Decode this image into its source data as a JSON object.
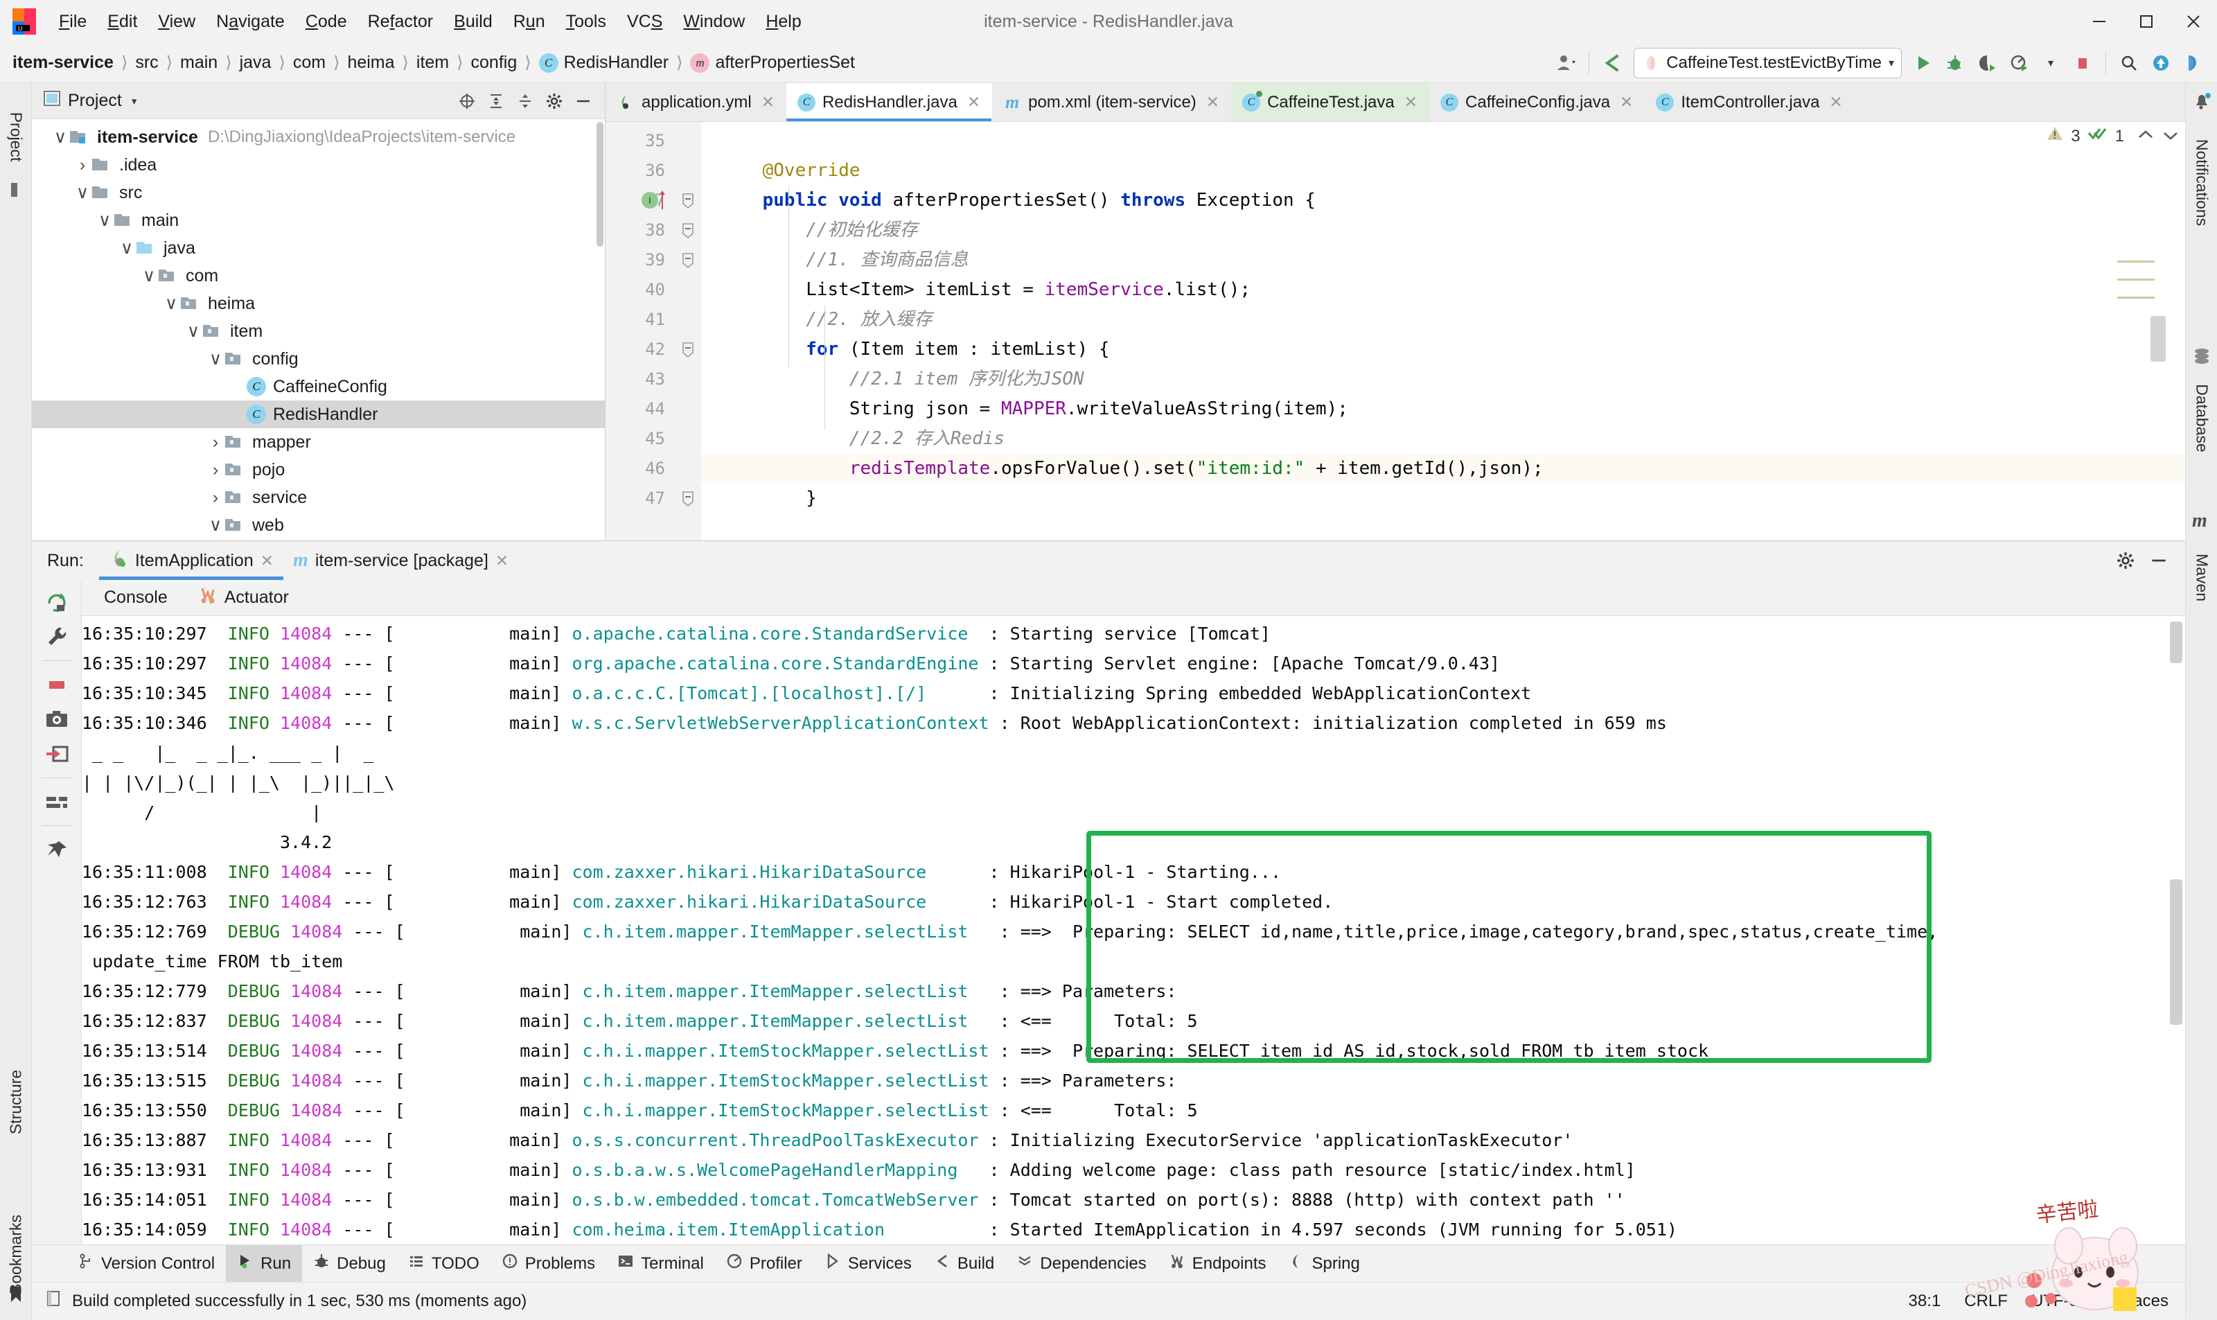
{
  "window": {
    "title": "item-service - RedisHandler.java",
    "logo_name": "intellij-idea-logo"
  },
  "menubar": {
    "items": [
      "File",
      "Edit",
      "View",
      "Navigate",
      "Code",
      "Refactor",
      "Build",
      "Run",
      "Tools",
      "VCS",
      "Window",
      "Help"
    ]
  },
  "window_controls": {
    "minimize": "minimize-button",
    "maximize": "maximize-button",
    "close": "close-button"
  },
  "navbar": {
    "crumbs": [
      {
        "label": "item-service",
        "bold": true,
        "badge": ""
      },
      {
        "label": "src",
        "bold": false,
        "badge": ""
      },
      {
        "label": "main",
        "bold": false,
        "badge": ""
      },
      {
        "label": "java",
        "bold": false,
        "badge": ""
      },
      {
        "label": "com",
        "bold": false,
        "badge": ""
      },
      {
        "label": "heima",
        "bold": false,
        "badge": ""
      },
      {
        "label": "item",
        "bold": false,
        "badge": ""
      },
      {
        "label": "config",
        "bold": false,
        "badge": ""
      },
      {
        "label": "RedisHandler",
        "bold": false,
        "badge": "C"
      },
      {
        "label": "afterPropertiesSet",
        "bold": false,
        "badge": "m"
      }
    ],
    "separator": "›",
    "run_config": "CaffeineTest.testEvictByTime",
    "run_config_caret": "▾",
    "buttons": [
      "user-icon",
      "vcs-update-icon",
      "run-button",
      "debug-button",
      "run-coverage-button",
      "profile-button",
      "stop-button",
      "search-everywhere-button",
      "update-project-button",
      "ide-assistant-button"
    ]
  },
  "project_pane": {
    "title": "Project",
    "caret": "▾",
    "toolbar_icons": [
      "scroll-from-source-icon",
      "expand-all-icon",
      "collapse-all-icon",
      "settings-gear-icon",
      "hide-icon"
    ],
    "tree": [
      {
        "depth": 0,
        "twist": "∨",
        "icon": "module",
        "label": "item-service",
        "bold": true,
        "path": "D:\\DingJiaxiong\\IdeaProjects\\item-service",
        "selected": false
      },
      {
        "depth": 1,
        "twist": "›",
        "icon": "folder",
        "label": ".idea",
        "bold": false,
        "path": "",
        "selected": false
      },
      {
        "depth": 1,
        "twist": "∨",
        "icon": "folder",
        "label": "src",
        "bold": false,
        "path": "",
        "selected": false
      },
      {
        "depth": 2,
        "twist": "∨",
        "icon": "folder",
        "label": "main",
        "bold": false,
        "path": "",
        "selected": false
      },
      {
        "depth": 3,
        "twist": "∨",
        "icon": "source-folder",
        "label": "java",
        "bold": false,
        "path": "",
        "selected": false
      },
      {
        "depth": 4,
        "twist": "∨",
        "icon": "package",
        "label": "com",
        "bold": false,
        "path": "",
        "selected": false
      },
      {
        "depth": 5,
        "twist": "∨",
        "icon": "package",
        "label": "heima",
        "bold": false,
        "path": "",
        "selected": false
      },
      {
        "depth": 6,
        "twist": "∨",
        "icon": "package",
        "label": "item",
        "bold": false,
        "path": "",
        "selected": false
      },
      {
        "depth": 7,
        "twist": "∨",
        "icon": "package",
        "label": "config",
        "bold": false,
        "path": "",
        "selected": false
      },
      {
        "depth": 8,
        "twist": "",
        "icon": "class",
        "label": "CaffeineConfig",
        "bold": false,
        "path": "",
        "selected": false
      },
      {
        "depth": 8,
        "twist": "",
        "icon": "class",
        "label": "RedisHandler",
        "bold": false,
        "path": "",
        "selected": true
      },
      {
        "depth": 7,
        "twist": "›",
        "icon": "package",
        "label": "mapper",
        "bold": false,
        "path": "",
        "selected": false
      },
      {
        "depth": 7,
        "twist": "›",
        "icon": "package",
        "label": "pojo",
        "bold": false,
        "path": "",
        "selected": false
      },
      {
        "depth": 7,
        "twist": "›",
        "icon": "package",
        "label": "service",
        "bold": false,
        "path": "",
        "selected": false
      },
      {
        "depth": 7,
        "twist": "∨",
        "icon": "package",
        "label": "web",
        "bold": false,
        "path": "",
        "selected": false
      }
    ]
  },
  "editor": {
    "tabs": [
      {
        "label": "application.yml",
        "icon": "yaml-file-icon",
        "state": "normal"
      },
      {
        "label": "RedisHandler.java",
        "icon": "java-class-icon",
        "state": "active"
      },
      {
        "label": "pom.xml (item-service)",
        "icon": "maven-file-icon",
        "state": "normal"
      },
      {
        "label": "CaffeineTest.java",
        "icon": "java-test-icon",
        "state": "test"
      },
      {
        "label": "CaffeineConfig.java",
        "icon": "java-class-icon",
        "state": "normal"
      },
      {
        "label": "ItemController.java",
        "icon": "java-class-icon",
        "state": "normal"
      }
    ],
    "close_glyph": "✕",
    "inspection": {
      "warning_count": "3",
      "ok_count": "1",
      "up": "⌃",
      "down": "⌄",
      "kebab": "⋮"
    },
    "lines": [
      {
        "num": "35",
        "fold": "",
        "html": "",
        "highlight": false
      },
      {
        "num": "36",
        "fold": "",
        "html": "    <span class=\"ann\">@Override</span>",
        "highlight": false
      },
      {
        "num": "37",
        "fold": "minus",
        "html": "    <span class=\"kw\">public</span> <span class=\"kw\">void</span> afterPropertiesSet() <span class=\"kw\">throws</span> Exception {",
        "highlight": false
      },
      {
        "num": "38",
        "fold": "minus",
        "html": "        <span class=\"cmt\">//初始化缓存</span>",
        "highlight": false
      },
      {
        "num": "39",
        "fold": "minus",
        "html": "        <span class=\"cmt\">//1. 查询商品信息</span>",
        "highlight": false
      },
      {
        "num": "40",
        "fold": "",
        "html": "        List&lt;Item&gt; itemList = <span class=\"fld\">itemService</span>.list();",
        "highlight": false
      },
      {
        "num": "41",
        "fold": "",
        "html": "        <span class=\"cmt\">//2. 放入缓存</span>",
        "highlight": false
      },
      {
        "num": "42",
        "fold": "minus",
        "html": "        <span class=\"kw\">for</span> (Item item : itemList) {",
        "highlight": false
      },
      {
        "num": "43",
        "fold": "",
        "html": "            <span class=\"cmt\">//2.1 item 序列化为JSON</span>",
        "highlight": false
      },
      {
        "num": "44",
        "fold": "",
        "html": "            String json = <span class=\"fld\">MAPPER</span>.writeValueAsString(item);",
        "highlight": false
      },
      {
        "num": "45",
        "fold": "",
        "html": "            <span class=\"cmt\">//2.2 存入Redis</span>",
        "highlight": false
      },
      {
        "num": "46",
        "fold": "",
        "html": "            <span class=\"fld\">redisTemplate</span>.opsForValue().set(<span class=\"str\">\"item:id:\"</span> + item.getId(),json);",
        "highlight": true
      },
      {
        "num": "47",
        "fold": "minus",
        "html": "        }",
        "highlight": false
      }
    ]
  },
  "run_window": {
    "label": "Run:",
    "tabs": [
      {
        "label": "ItemApplication",
        "icon": "spring-boot-run-icon",
        "active": true
      },
      {
        "label": "item-service [package]",
        "icon": "maven-run-icon",
        "active": false
      }
    ],
    "close_glyph": "✕",
    "header_buttons": [
      "settings-gear-icon",
      "hide-icon"
    ],
    "side_icons": [
      "rerun-icon",
      "edit-configuration-icon",
      "stop-icon",
      "screenshot-icon",
      "export-icon",
      "soft-wrap-icon",
      "pin-icon"
    ],
    "console_tabs": [
      {
        "label": "Console",
        "icon": "console-icon"
      },
      {
        "label": "Actuator",
        "icon": "actuator-icon"
      }
    ],
    "console_lines": [
      {
        "type": "log",
        "time": "16:35:10:297",
        "level": "INFO",
        "pid": "14084",
        "thread": "main",
        "logger": "o.apache.catalina.core.StandardService",
        "msg": "Starting service [Tomcat]",
        "clip_top": true
      },
      {
        "type": "log",
        "time": "16:35:10:297",
        "level": "INFO",
        "pid": "14084",
        "thread": "main",
        "logger": "org.apache.catalina.core.StandardEngine",
        "msg": "Starting Servlet engine: [Apache Tomcat/9.0.43]"
      },
      {
        "type": "log",
        "time": "16:35:10:345",
        "level": "INFO",
        "pid": "14084",
        "thread": "main",
        "logger": "o.a.c.c.C.[Tomcat].[localhost].[/]",
        "msg": "Initializing Spring embedded WebApplicationContext"
      },
      {
        "type": "log",
        "time": "16:35:10:346",
        "level": "INFO",
        "pid": "14084",
        "thread": "main",
        "logger": "w.s.c.ServletWebServerApplicationContext",
        "msg": "Root WebApplicationContext: initialization completed in 659 ms"
      },
      {
        "type": "banner",
        "text": " _ _   |_  _ _|_. ___ _ |  _"
      },
      {
        "type": "banner",
        "text": "| | |\\/|_)(_| | |_\\  |_)||_|_\\"
      },
      {
        "type": "banner",
        "text": "      /               |"
      },
      {
        "type": "banner",
        "text": "                   3.4.2"
      },
      {
        "type": "log",
        "time": "16:35:11:008",
        "level": "INFO",
        "pid": "14084",
        "thread": "main",
        "logger": "com.zaxxer.hikari.HikariDataSource",
        "msg": "HikariPool-1 - Starting..."
      },
      {
        "type": "log",
        "time": "16:35:12:763",
        "level": "INFO",
        "pid": "14084",
        "thread": "main",
        "logger": "com.zaxxer.hikari.HikariDataSource",
        "msg": "HikariPool-1 - Start completed."
      },
      {
        "type": "log",
        "time": "16:35:12:769",
        "level": "DEBUG",
        "pid": "14084",
        "thread": "main",
        "logger": "c.h.item.mapper.ItemMapper.selectList",
        "msg": "==>  Preparing: SELECT id,name,title,price,image,category,brand,spec,status,create_time,"
      },
      {
        "type": "cont",
        "text": " update_time FROM tb_item"
      },
      {
        "type": "log",
        "time": "16:35:12:779",
        "level": "DEBUG",
        "pid": "14084",
        "thread": "main",
        "logger": "c.h.item.mapper.ItemMapper.selectList",
        "msg": "==> Parameters:"
      },
      {
        "type": "log",
        "time": "16:35:12:837",
        "level": "DEBUG",
        "pid": "14084",
        "thread": "main",
        "logger": "c.h.item.mapper.ItemMapper.selectList",
        "msg": "<==      Total: 5"
      },
      {
        "type": "log",
        "time": "16:35:13:514",
        "level": "DEBUG",
        "pid": "14084",
        "thread": "main",
        "logger": "c.h.i.mapper.ItemStockMapper.selectList",
        "msg": "==>  Preparing: SELECT item_id AS id,stock,sold FROM tb_item_stock"
      },
      {
        "type": "log",
        "time": "16:35:13:515",
        "level": "DEBUG",
        "pid": "14084",
        "thread": "main",
        "logger": "c.h.i.mapper.ItemStockMapper.selectList",
        "msg": "==> Parameters:"
      },
      {
        "type": "log",
        "time": "16:35:13:550",
        "level": "DEBUG",
        "pid": "14084",
        "thread": "main",
        "logger": "c.h.i.mapper.ItemStockMapper.selectList",
        "msg": "<==      Total: 5"
      },
      {
        "type": "log",
        "time": "16:35:13:887",
        "level": "INFO",
        "pid": "14084",
        "thread": "main",
        "logger": "o.s.s.concurrent.ThreadPoolTaskExecutor",
        "msg": "Initializing ExecutorService 'applicationTaskExecutor'"
      },
      {
        "type": "log",
        "time": "16:35:13:931",
        "level": "INFO",
        "pid": "14084",
        "thread": "main",
        "logger": "o.s.b.a.w.s.WelcomePageHandlerMapping",
        "msg": "Adding welcome page: class path resource [static/index.html]"
      },
      {
        "type": "log",
        "time": "16:35:14:051",
        "level": "INFO",
        "pid": "14084",
        "thread": "main",
        "logger": "o.s.b.w.embedded.tomcat.TomcatWebServer",
        "msg": "Tomcat started on port(s): 8888 (http) with context path ''"
      },
      {
        "type": "log",
        "time": "16:35:14:059",
        "level": "INFO",
        "pid": "14084",
        "thread": "main",
        "logger": "com.heima.item.ItemApplication",
        "msg": "Started ItemApplication in 4.597 seconds (JVM running for 5.051)"
      }
    ],
    "highlight_box_color": "#22b24c"
  },
  "left_rail": {
    "top_labels": [
      "Project"
    ],
    "bottom_labels": [
      "Structure",
      "Bookmarks"
    ]
  },
  "right_rail": {
    "labels": [
      "Notifications",
      "Database",
      "Maven"
    ]
  },
  "bottom_bar": {
    "items": [
      {
        "label": "Version Control",
        "icon": "branch-icon",
        "active": false
      },
      {
        "label": "Run",
        "icon": "run-icon",
        "active": true
      },
      {
        "label": "Debug",
        "icon": "debug-icon",
        "active": false
      },
      {
        "label": "TODO",
        "icon": "todo-icon",
        "active": false
      },
      {
        "label": "Problems",
        "icon": "problems-icon",
        "active": false
      },
      {
        "label": "Terminal",
        "icon": "terminal-icon",
        "active": false
      },
      {
        "label": "Profiler",
        "icon": "profiler-icon",
        "active": false
      },
      {
        "label": "Services",
        "icon": "services-icon",
        "active": false
      },
      {
        "label": "Build",
        "icon": "build-icon",
        "active": false
      },
      {
        "label": "Dependencies",
        "icon": "dependencies-icon",
        "active": false
      },
      {
        "label": "Endpoints",
        "icon": "endpoints-icon",
        "active": false
      },
      {
        "label": "Spring",
        "icon": "spring-icon",
        "active": false
      }
    ]
  },
  "status_bar": {
    "message": "Build completed successfully in 1 sec, 530 ms (moments ago)",
    "icon": "build-status-icon",
    "caret_position": "38:1",
    "line_separator": "CRLF",
    "encoding": "UTF-8",
    "indent": "4 spaces",
    "watermark": "CSDN @DingJiaxiong"
  },
  "colors": {
    "accent": "#4a90d9",
    "highlight_green": "#22b24c",
    "selection": "#d6d6d6",
    "keyword": "#0033b3",
    "string": "#067d17",
    "comment": "#8c8c8c",
    "field": "#871094",
    "logger": "#0d8f8f",
    "pid": "#c939c9",
    "level": "#1f7a1f"
  }
}
